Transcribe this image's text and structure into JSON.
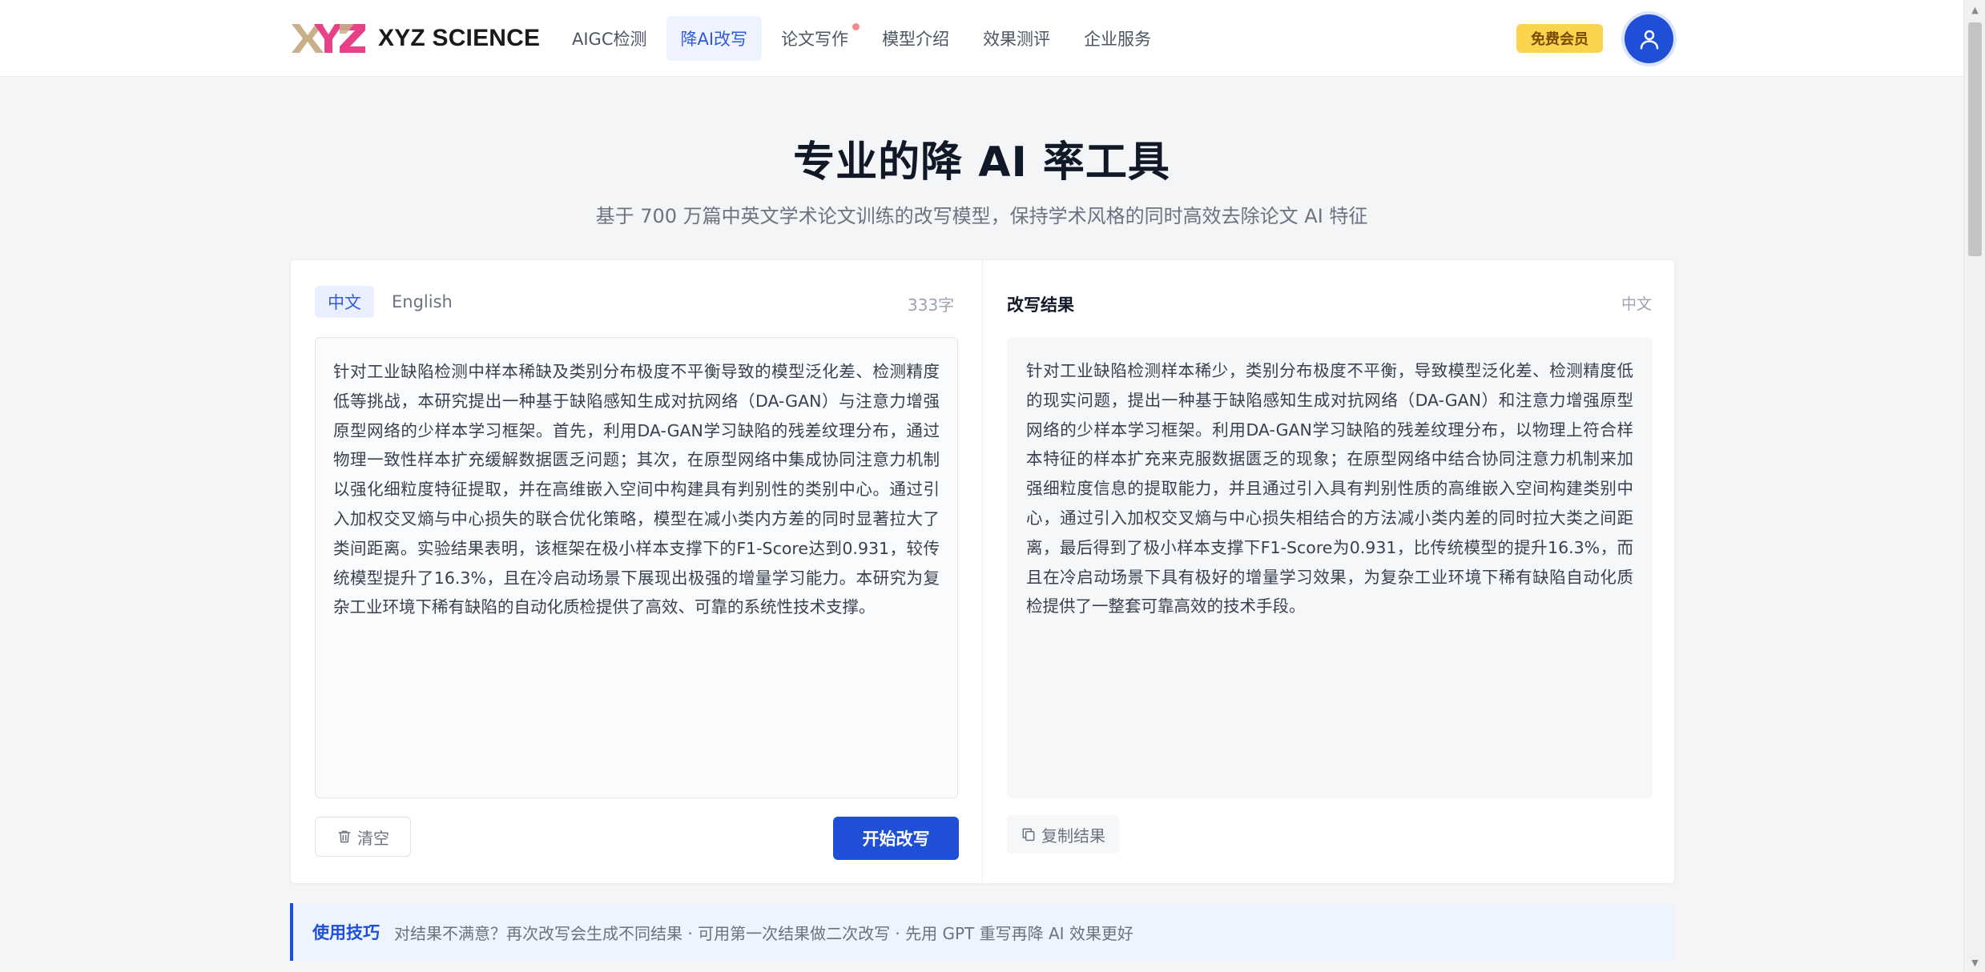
{
  "header": {
    "brand": "XYZ SCIENCE",
    "nav": [
      {
        "label": "AIGC检测",
        "active": false,
        "dot": false
      },
      {
        "label": "降AI改写",
        "active": true,
        "dot": false
      },
      {
        "label": "论文写作",
        "active": false,
        "dot": true
      },
      {
        "label": "模型介绍",
        "active": false,
        "dot": false
      },
      {
        "label": "效果测评",
        "active": false,
        "dot": false
      },
      {
        "label": "企业服务",
        "active": false,
        "dot": false
      }
    ],
    "vip_label": "免费会员",
    "avatar_icon": "user-icon"
  },
  "hero": {
    "title": "专业的降 AI 率工具",
    "subtitle": "基于 700 万篇中英文学术论文训练的改写模型，保持学术风格的同时高效去除论文 AI 特征"
  },
  "input_panel": {
    "tabs": [
      "中文",
      "English"
    ],
    "active_tab": "中文",
    "char_count": "333字",
    "text": "针对工业缺陷检测中样本稀缺及类别分布极度不平衡导致的模型泛化差、检测精度低等挑战，本研究提出一种基于缺陷感知生成对抗网络（DA-GAN）与注意力增强原型网络的少样本学习框架。首先，利用DA-GAN学习缺陷的残差纹理分布，通过物理一致性样本扩充缓解数据匮乏问题；其次，在原型网络中集成协同注意力机制以强化细粒度特征提取，并在高维嵌入空间中构建具有判别性的类别中心。通过引入加权交叉熵与中心损失的联合优化策略，模型在减小类内方差的同时显著拉大了类间距离。实验结果表明，该框架在极小样本支撑下的F1-Score达到0.931，较传统模型提升了16.3%，且在冷启动场景下展现出极强的增量学习能力。本研究为复杂工业环境下稀有缺陷的自动化质检提供了高效、可靠的系统性技术支撑。",
    "clear_label": "清空",
    "start_label": "开始改写"
  },
  "result_panel": {
    "title": "改写结果",
    "lang": "中文",
    "text": "针对工业缺陷检测样本稀少，类别分布极度不平衡，导致模型泛化差、检测精度低的现实问题，提出一种基于缺陷感知生成对抗网络（DA-GAN）和注意力增强原型网络的少样本学习框架。利用DA-GAN学习缺陷的残差纹理分布，以物理上符合样本特征的样本扩充来克服数据匮乏的现象；在原型网络中结合协同注意力机制来加强细粒度信息的提取能力，并且通过引入具有判别性质的高维嵌入空间构建类别中心，通过引入加权交叉熵与中心损失相结合的方法减小类内差的同时拉大类之间距离，最后得到了极小样本支撑下F1-Score为0.931，比传统模型的提升16.3%，而且在冷启动场景下具有极好的增量学习效果，为复杂工业环境下稀有缺陷自动化质检提供了一整套可靠高效的技术手段。",
    "copy_label": "复制结果"
  },
  "tips": {
    "label": "使用技巧",
    "text": "对结果不满意？再次改写会生成不同结果 · 可用第一次结果做二次改写 · 先用 GPT 重写再降 AI 效果更好"
  },
  "colors": {
    "primary": "#1f4fd6",
    "vip": "#fbd44d",
    "active_tab_bg": "#e9efff"
  }
}
